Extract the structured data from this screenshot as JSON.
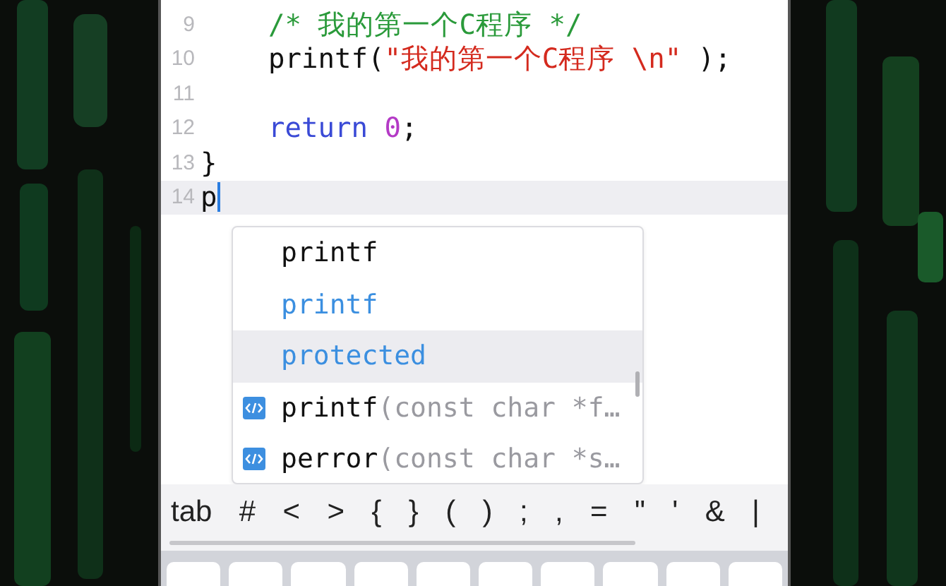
{
  "editor": {
    "lines": [
      {
        "number": "9",
        "current": false,
        "indented": true,
        "tokens": [
          {
            "kind": "comment",
            "text": "/* 我的第一个C程序 */"
          }
        ]
      },
      {
        "number": "10",
        "current": false,
        "indented": true,
        "tokens": [
          {
            "kind": "plain",
            "text": "printf("
          },
          {
            "kind": "string",
            "text": "\"我的第一个C程序 \\n\""
          },
          {
            "kind": "plain",
            "text": " );"
          }
        ]
      },
      {
        "number": "11",
        "current": false
      },
      {
        "number": "12",
        "current": false,
        "indented": true,
        "tokens": [
          {
            "kind": "keyword",
            "text": "return "
          },
          {
            "kind": "number",
            "text": "0"
          },
          {
            "kind": "plain",
            "text": ";"
          }
        ]
      },
      {
        "number": "13",
        "current": false,
        "indented": false,
        "tokens": [
          {
            "kind": "plain",
            "text": "}"
          }
        ]
      },
      {
        "number": "14",
        "current": true,
        "indented": false,
        "tokens": [
          {
            "kind": "plain",
            "text": "p"
          }
        ]
      }
    ]
  },
  "autocomplete": {
    "items": [
      {
        "kind": "word",
        "label": "printf",
        "selected": false
      },
      {
        "kind": "keyword",
        "label": "printf",
        "selected": false
      },
      {
        "kind": "keyword",
        "label": "protected",
        "selected": true
      },
      {
        "kind": "function",
        "label": "printf",
        "detail": "(const char *f…",
        "selected": false
      },
      {
        "kind": "function",
        "label": "perror",
        "detail": "(const char *s…",
        "selected": false
      }
    ]
  },
  "key_bar": {
    "keys": [
      "tab",
      "#",
      "<",
      ">",
      "{",
      "}",
      "(",
      ")",
      ";",
      ",",
      "=",
      "\"",
      "'",
      "&",
      "|"
    ]
  }
}
